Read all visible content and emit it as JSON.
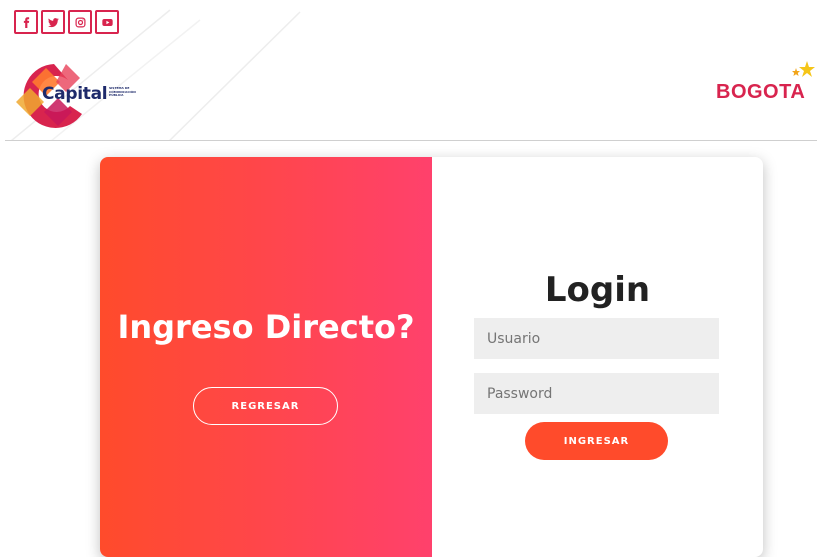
{
  "header": {
    "social": [
      {
        "icon": "facebook-icon"
      },
      {
        "icon": "twitter-icon"
      },
      {
        "icon": "instagram-icon"
      },
      {
        "icon": "youtube-icon"
      }
    ],
    "capital_logo": {
      "word": "Capital",
      "tagline": "SISTEMA DE COMUNICACIÓN PÚBLICA"
    },
    "bogota_logo": {
      "word": "BOGOTA"
    }
  },
  "left_panel": {
    "title": "Ingreso Directo?",
    "back_button": "REGRESAR"
  },
  "login": {
    "title": "Login",
    "username_placeholder": "Usuario",
    "password_placeholder": "Password",
    "submit_button": "INGRESAR"
  },
  "colors": {
    "brand_red": "#d8244e",
    "gradient_start": "#ff4b2b",
    "gradient_end": "#ff416c",
    "navy": "#1e2a6b"
  }
}
